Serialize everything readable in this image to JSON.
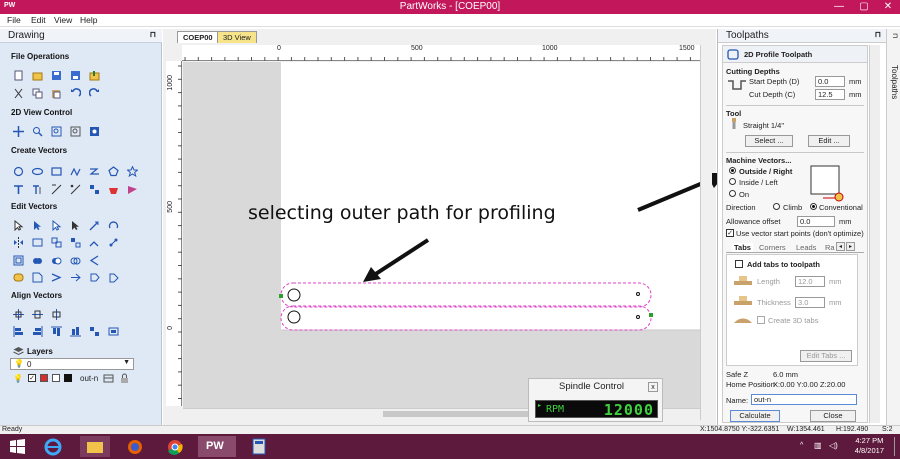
{
  "app": {
    "logo": "PW",
    "title": "PartWorks - [COEP00]"
  },
  "window_buttons": {
    "minimize": "—",
    "maximize": "▢",
    "close": "✕"
  },
  "menu": [
    "File",
    "Edit",
    "View",
    "Help"
  ],
  "left_panel": {
    "title": "Drawing",
    "pin": "⊓",
    "sections": {
      "file_ops": "File Operations",
      "view_ctrl": "2D View Control",
      "create_vectors": "Create Vectors",
      "edit_vectors": "Edit Vectors",
      "align_vectors": "Align Vectors"
    },
    "layers": {
      "label": "Layers",
      "current_layer": "0",
      "layer_name": "out-n"
    }
  },
  "tabs": [
    {
      "label": "COEP00"
    },
    {
      "label": "3D View"
    }
  ],
  "ruler": {
    "h_ticks": [
      "0",
      "500",
      "1000",
      "1500"
    ],
    "v_ticks": [
      "1000",
      "500",
      "0"
    ]
  },
  "annotation": "selecting outer path for profiling",
  "spindle": {
    "title": "Spindle Control",
    "close": "x",
    "rpm_label": "RPM",
    "rpm_value": "12000"
  },
  "right_panel": {
    "title": "Toolpaths",
    "pin": "⊓",
    "vertical_tab": "Toolpaths",
    "header": "2D Profile Toolpath",
    "cutting_depths": {
      "label": "Cutting Depths",
      "start_label": "Start Depth (D)",
      "start_value": "0.0",
      "cut_label": "Cut Depth (C)",
      "cut_value": "12.5",
      "unit": "mm"
    },
    "tool": {
      "label": "Tool",
      "name": "Straight 1/4\"",
      "select_btn": "Select ...",
      "edit_btn": "Edit ..."
    },
    "machine_vectors": {
      "label": "Machine Vectors...",
      "options": [
        "Outside / Right",
        "Inside / Left",
        "On"
      ],
      "selected": "Outside / Right"
    },
    "direction": {
      "label": "Direction",
      "climb": "Climb",
      "conventional": "Conventional",
      "selected": "Conventional"
    },
    "allowance": {
      "label": "Allowance offset",
      "value": "0.0",
      "unit": "mm"
    },
    "use_vector_start": {
      "label": "Use vector start points (don't optimize)",
      "checked": true
    },
    "subtabs": [
      "Tabs",
      "Corners",
      "Leads",
      "Ra"
    ],
    "tabs_panel": {
      "add_label": "Add tabs to toolpath",
      "length_label": "Length",
      "length_value": "12.0",
      "thickness_label": "Thickness",
      "thickness_value": "3.0",
      "unit": "mm",
      "create3d_label": "Create 3D tabs",
      "edit_tabs_btn": "Edit Tabs ..."
    },
    "safe_z": {
      "label": "Safe Z",
      "value": "6.0 mm"
    },
    "home": {
      "label": "Home Position",
      "value": "X:0.00 Y:0.00 Z:20.00"
    },
    "name": {
      "label": "Name:",
      "value": "out-n"
    },
    "calculate_btn": "Calculate",
    "close_btn": "Close"
  },
  "status": {
    "left": "Ready",
    "coords": "X:1504.8750 Y:-322.6351",
    "width": "W:1354.461",
    "height": "H:192.490",
    "selection": "S:2"
  },
  "taskbar": {
    "time": "4:27 PM",
    "date": "4/8/2017",
    "pw_label": "PW"
  }
}
